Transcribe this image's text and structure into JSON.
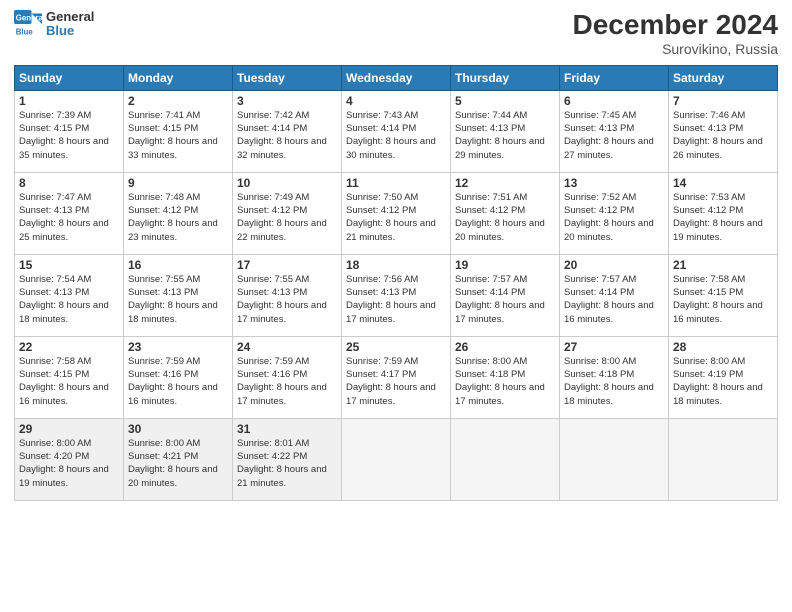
{
  "header": {
    "logo_line1": "General",
    "logo_line2": "Blue",
    "month_year": "December 2024",
    "location": "Surovikino, Russia"
  },
  "days_of_week": [
    "Sunday",
    "Monday",
    "Tuesday",
    "Wednesday",
    "Thursday",
    "Friday",
    "Saturday"
  ],
  "weeks": [
    [
      {
        "day": 1,
        "sunrise": "7:39 AM",
        "sunset": "4:15 PM",
        "daylight": "8 hours and 35 minutes."
      },
      {
        "day": 2,
        "sunrise": "7:41 AM",
        "sunset": "4:15 PM",
        "daylight": "8 hours and 33 minutes."
      },
      {
        "day": 3,
        "sunrise": "7:42 AM",
        "sunset": "4:14 PM",
        "daylight": "8 hours and 32 minutes."
      },
      {
        "day": 4,
        "sunrise": "7:43 AM",
        "sunset": "4:14 PM",
        "daylight": "8 hours and 30 minutes."
      },
      {
        "day": 5,
        "sunrise": "7:44 AM",
        "sunset": "4:13 PM",
        "daylight": "8 hours and 29 minutes."
      },
      {
        "day": 6,
        "sunrise": "7:45 AM",
        "sunset": "4:13 PM",
        "daylight": "8 hours and 27 minutes."
      },
      {
        "day": 7,
        "sunrise": "7:46 AM",
        "sunset": "4:13 PM",
        "daylight": "8 hours and 26 minutes."
      }
    ],
    [
      {
        "day": 8,
        "sunrise": "7:47 AM",
        "sunset": "4:13 PM",
        "daylight": "8 hours and 25 minutes."
      },
      {
        "day": 9,
        "sunrise": "7:48 AM",
        "sunset": "4:12 PM",
        "daylight": "8 hours and 23 minutes."
      },
      {
        "day": 10,
        "sunrise": "7:49 AM",
        "sunset": "4:12 PM",
        "daylight": "8 hours and 22 minutes."
      },
      {
        "day": 11,
        "sunrise": "7:50 AM",
        "sunset": "4:12 PM",
        "daylight": "8 hours and 21 minutes."
      },
      {
        "day": 12,
        "sunrise": "7:51 AM",
        "sunset": "4:12 PM",
        "daylight": "8 hours and 20 minutes."
      },
      {
        "day": 13,
        "sunrise": "7:52 AM",
        "sunset": "4:12 PM",
        "daylight": "8 hours and 20 minutes."
      },
      {
        "day": 14,
        "sunrise": "7:53 AM",
        "sunset": "4:12 PM",
        "daylight": "8 hours and 19 minutes."
      }
    ],
    [
      {
        "day": 15,
        "sunrise": "7:54 AM",
        "sunset": "4:13 PM",
        "daylight": "8 hours and 18 minutes."
      },
      {
        "day": 16,
        "sunrise": "7:55 AM",
        "sunset": "4:13 PM",
        "daylight": "8 hours and 18 minutes."
      },
      {
        "day": 17,
        "sunrise": "7:55 AM",
        "sunset": "4:13 PM",
        "daylight": "8 hours and 17 minutes."
      },
      {
        "day": 18,
        "sunrise": "7:56 AM",
        "sunset": "4:13 PM",
        "daylight": "8 hours and 17 minutes."
      },
      {
        "day": 19,
        "sunrise": "7:57 AM",
        "sunset": "4:14 PM",
        "daylight": "8 hours and 17 minutes."
      },
      {
        "day": 20,
        "sunrise": "7:57 AM",
        "sunset": "4:14 PM",
        "daylight": "8 hours and 16 minutes."
      },
      {
        "day": 21,
        "sunrise": "7:58 AM",
        "sunset": "4:15 PM",
        "daylight": "8 hours and 16 minutes."
      }
    ],
    [
      {
        "day": 22,
        "sunrise": "7:58 AM",
        "sunset": "4:15 PM",
        "daylight": "8 hours and 16 minutes."
      },
      {
        "day": 23,
        "sunrise": "7:59 AM",
        "sunset": "4:16 PM",
        "daylight": "8 hours and 16 minutes."
      },
      {
        "day": 24,
        "sunrise": "7:59 AM",
        "sunset": "4:16 PM",
        "daylight": "8 hours and 17 minutes."
      },
      {
        "day": 25,
        "sunrise": "7:59 AM",
        "sunset": "4:17 PM",
        "daylight": "8 hours and 17 minutes."
      },
      {
        "day": 26,
        "sunrise": "8:00 AM",
        "sunset": "4:18 PM",
        "daylight": "8 hours and 17 minutes."
      },
      {
        "day": 27,
        "sunrise": "8:00 AM",
        "sunset": "4:18 PM",
        "daylight": "8 hours and 18 minutes."
      },
      {
        "day": 28,
        "sunrise": "8:00 AM",
        "sunset": "4:19 PM",
        "daylight": "8 hours and 18 minutes."
      }
    ],
    [
      {
        "day": 29,
        "sunrise": "8:00 AM",
        "sunset": "4:20 PM",
        "daylight": "8 hours and 19 minutes."
      },
      {
        "day": 30,
        "sunrise": "8:00 AM",
        "sunset": "4:21 PM",
        "daylight": "8 hours and 20 minutes."
      },
      {
        "day": 31,
        "sunrise": "8:01 AM",
        "sunset": "4:22 PM",
        "daylight": "8 hours and 21 minutes."
      },
      null,
      null,
      null,
      null
    ]
  ]
}
